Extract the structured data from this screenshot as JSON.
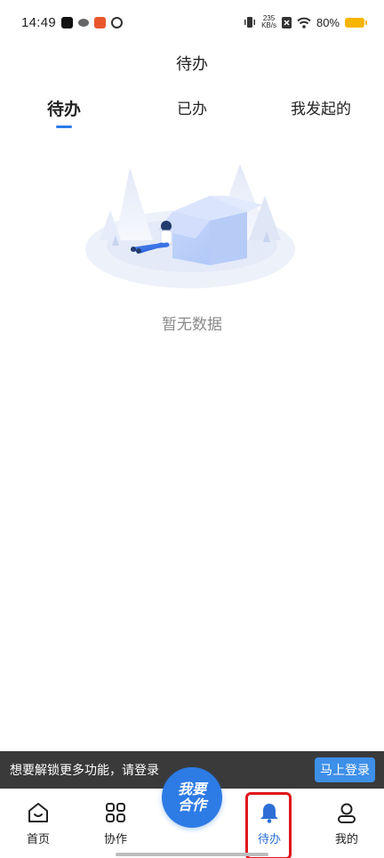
{
  "status_bar": {
    "time": "14:49",
    "net_speed_top": "235",
    "net_speed_bottom": "KB/s",
    "battery": "80%",
    "icons": [
      "tiktok-icon",
      "cloud-icon",
      "app-icon",
      "app-icon-2",
      "vibrate-icon",
      "sim-icon",
      "wifi-icon",
      "battery-icon"
    ]
  },
  "header": {
    "title": "待办"
  },
  "tabs": [
    {
      "label": "待办",
      "active": true
    },
    {
      "label": "已办",
      "active": false
    },
    {
      "label": "我发起的",
      "active": false
    }
  ],
  "empty_state": {
    "message": "暂无数据",
    "illustration": "empty-box-icon"
  },
  "login_banner": {
    "message": "想要解锁更多功能，请登录",
    "button_label": "马上登录"
  },
  "bottom_nav": {
    "items": [
      {
        "label": "首页",
        "icon": "home-icon"
      },
      {
        "label": "协作",
        "icon": "grid-icon"
      },
      {
        "label": "待办",
        "icon": "bell-icon",
        "active": true
      },
      {
        "label": "我的",
        "icon": "user-icon"
      }
    ],
    "center_button": {
      "line1": "我要",
      "line2": "合作"
    }
  },
  "colors": {
    "accent": "#2d7be5",
    "banner_bg": "#3a3a3a",
    "highlight": "#e0161b"
  }
}
